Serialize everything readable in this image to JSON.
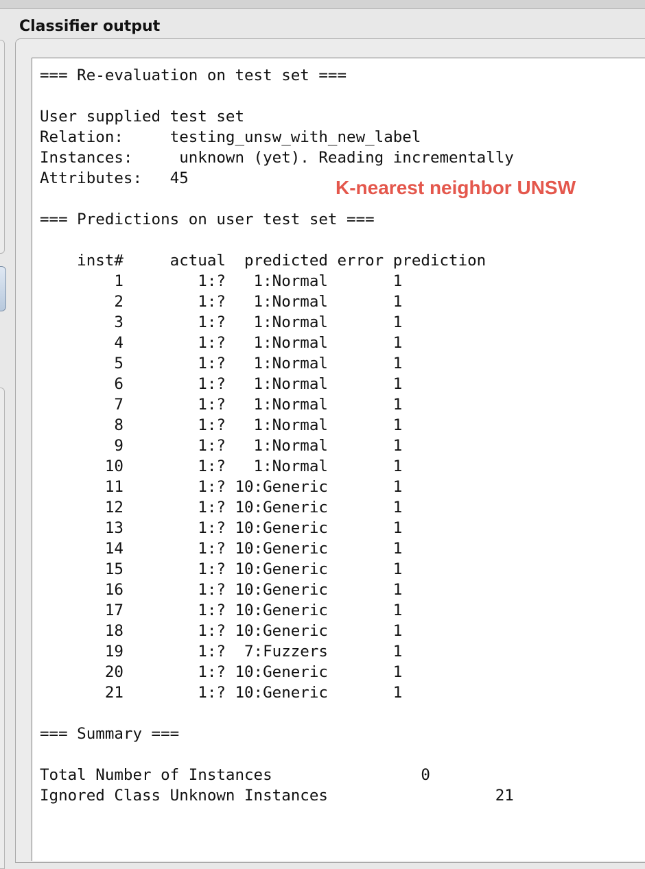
{
  "panel": {
    "title": "Classifier output"
  },
  "overlay_label": "K-nearest neighbor UNSW",
  "output": {
    "header": "=== Re-evaluation on test set ===",
    "meta": [
      "User supplied test set",
      "Relation:     testing_unsw_with_new_label",
      "Instances:     unknown (yet). Reading incrementally",
      "Attributes:   45"
    ],
    "predictions_header": "=== Predictions on user test set ===",
    "columns": "    inst#     actual  predicted error prediction",
    "rows": [
      "        1        1:?   1:Normal       1",
      "        2        1:?   1:Normal       1",
      "        3        1:?   1:Normal       1",
      "        4        1:?   1:Normal       1",
      "        5        1:?   1:Normal       1",
      "        6        1:?   1:Normal       1",
      "        7        1:?   1:Normal       1",
      "        8        1:?   1:Normal       1",
      "        9        1:?   1:Normal       1",
      "       10        1:?   1:Normal       1",
      "       11        1:? 10:Generic       1",
      "       12        1:? 10:Generic       1",
      "       13        1:? 10:Generic       1",
      "       14        1:? 10:Generic       1",
      "       15        1:? 10:Generic       1",
      "       16        1:? 10:Generic       1",
      "       17        1:? 10:Generic       1",
      "       18        1:? 10:Generic       1",
      "       19        1:?  7:Fuzzers       1",
      "       20        1:? 10:Generic       1",
      "       21        1:? 10:Generic       1"
    ],
    "summary_header": "=== Summary ===",
    "summary": [
      "Total Number of Instances                0",
      "Ignored Class Unknown Instances                  21"
    ]
  },
  "colors": {
    "overlay": "#e4574c",
    "text": "#111111",
    "panel_bg": "#ececec"
  }
}
